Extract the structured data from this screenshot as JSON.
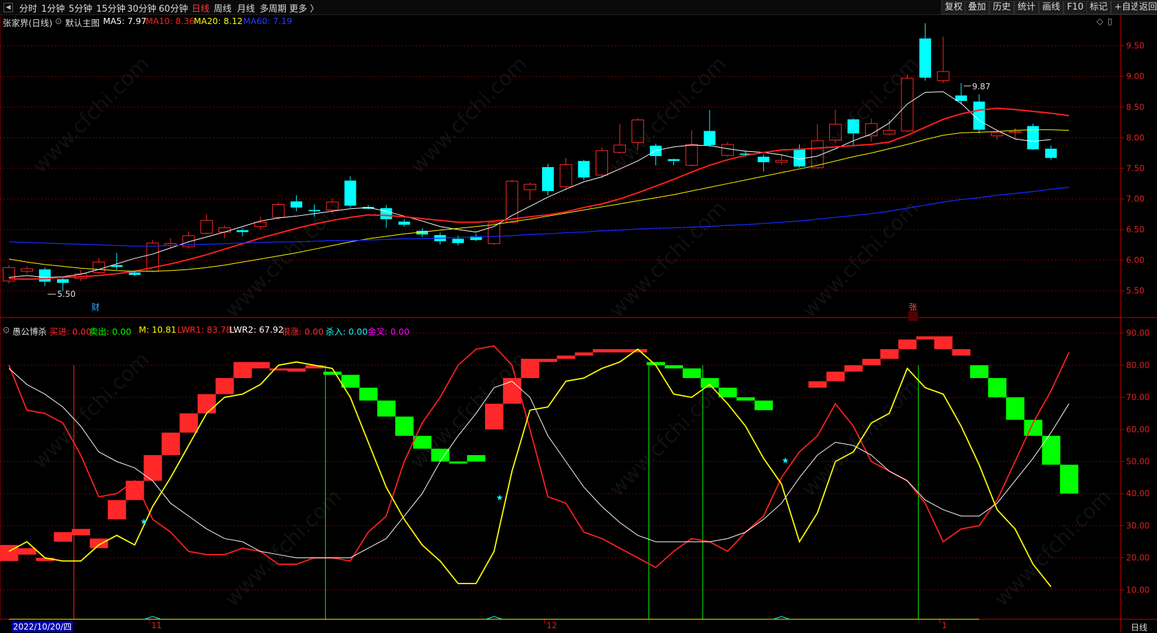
{
  "toolbar": {
    "left_items": [
      "分时",
      "1分钟",
      "5分钟",
      "15分钟",
      "30分钟",
      "60分钟",
      "日线",
      "周线",
      "月线",
      "多周期",
      "更多 〉"
    ],
    "active_item": "日线",
    "right_items": [
      "复权",
      "叠加",
      "历史",
      "统计",
      "画线",
      "F10",
      "标记",
      "+自选",
      "返回"
    ]
  },
  "main_legend": {
    "stock": "张家界(日线)",
    "main_title": "默认主图",
    "ma5": "MA5: 7.97",
    "ma10": "MA10: 8.36",
    "ma20": "MA20: 8.12",
    "ma60": "MA60: 7.19"
  },
  "sub_legend": {
    "title": "愚公博杀",
    "buy": "买进: 0.00",
    "sell": "卖出: 0.00",
    "m": "M: 10.81",
    "lwr1": "LWR1: 83.78",
    "lwr2": "LWR2: 67.92",
    "escape": "很涨: 0.00",
    "kill": "杀入: 0.00",
    "cross": "金叉: 0.00"
  },
  "colors": {
    "up": "#ff2828",
    "down": "#00ffff",
    "ma5": "#ffffff",
    "ma10": "#ff2020",
    "ma20": "#ffff00",
    "ma60": "#1428ff",
    "grid": "#800000",
    "axis": "#cc0000",
    "green_bar": "#00ff00"
  },
  "watermark": "www.cfchi.com",
  "date_flag": "2022/10/20/四",
  "period_label": "日线",
  "markers": {
    "cai": "财",
    "zhang": "张"
  },
  "chart_data": [
    {
      "type": "candlestick",
      "title": "张家界(日线)",
      "ylim": [
        5.3,
        9.9
      ],
      "yticks": [
        5.5,
        6.0,
        6.5,
        7.0,
        7.5,
        8.0,
        8.5,
        9.0,
        9.5
      ],
      "x_labels": [
        {
          "index": 8,
          "label": "11"
        },
        {
          "index": 30,
          "label": "12"
        },
        {
          "index": 52,
          "label": "1"
        }
      ],
      "annotations": [
        {
          "index": 2,
          "text": "5.50",
          "type": "low"
        },
        {
          "index": 53,
          "text": "9.87",
          "type": "high"
        }
      ],
      "candles": [
        [
          5.66,
          5.88,
          5.92,
          5.62
        ],
        [
          5.82,
          5.86,
          5.9,
          5.78
        ],
        [
          5.85,
          5.65,
          5.88,
          5.58
        ],
        [
          5.69,
          5.63,
          5.72,
          5.5
        ],
        [
          5.7,
          5.78,
          5.84,
          5.66
        ],
        [
          5.8,
          5.97,
          6.04,
          5.78
        ],
        [
          5.92,
          5.89,
          6.12,
          5.84
        ],
        [
          5.8,
          5.76,
          5.83,
          5.74
        ],
        [
          5.82,
          6.28,
          6.33,
          5.8
        ],
        [
          6.24,
          6.27,
          6.36,
          6.2
        ],
        [
          6.22,
          6.4,
          6.47,
          6.19
        ],
        [
          6.44,
          6.65,
          6.75,
          6.42
        ],
        [
          6.46,
          6.53,
          6.57,
          6.36
        ],
        [
          6.49,
          6.46,
          6.52,
          6.39
        ],
        [
          6.55,
          6.62,
          6.71,
          6.5
        ],
        [
          6.7,
          6.91,
          6.95,
          6.66
        ],
        [
          6.96,
          6.86,
          7.06,
          6.8
        ],
        [
          6.82,
          6.8,
          6.91,
          6.71
        ],
        [
          6.82,
          6.95,
          7.01,
          6.77
        ],
        [
          7.3,
          6.89,
          7.37,
          6.86
        ],
        [
          6.87,
          6.84,
          6.9,
          6.83
        ],
        [
          6.85,
          6.67,
          6.9,
          6.53
        ],
        [
          6.63,
          6.58,
          6.67,
          6.55
        ],
        [
          6.48,
          6.42,
          6.52,
          6.38
        ],
        [
          6.41,
          6.31,
          6.45,
          6.26
        ],
        [
          6.35,
          6.28,
          6.4,
          6.24
        ],
        [
          6.39,
          6.33,
          6.43,
          6.31
        ],
        [
          6.27,
          6.61,
          6.65,
          6.25
        ],
        [
          6.62,
          7.29,
          7.31,
          6.62
        ],
        [
          7.15,
          7.24,
          7.27,
          6.98
        ],
        [
          7.52,
          7.13,
          7.57,
          7.06
        ],
        [
          7.2,
          7.56,
          7.67,
          7.14
        ],
        [
          7.62,
          7.35,
          7.64,
          7.31
        ],
        [
          7.39,
          7.79,
          7.85,
          7.34
        ],
        [
          7.76,
          7.88,
          8.22,
          7.74
        ],
        [
          7.92,
          8.29,
          8.32,
          7.8
        ],
        [
          7.87,
          7.7,
          7.9,
          7.55
        ],
        [
          7.65,
          7.62,
          7.66,
          7.55
        ],
        [
          7.55,
          7.89,
          8.12,
          7.53
        ],
        [
          8.11,
          7.88,
          8.45,
          7.85
        ],
        [
          7.71,
          7.89,
          7.93,
          7.69
        ],
        [
          7.74,
          7.72,
          7.79,
          7.69
        ],
        [
          7.69,
          7.6,
          7.73,
          7.45
        ],
        [
          7.6,
          7.63,
          7.73,
          7.56
        ],
        [
          7.82,
          7.53,
          7.89,
          7.51
        ],
        [
          7.51,
          7.95,
          8.22,
          7.49
        ],
        [
          7.96,
          8.22,
          8.46,
          7.91
        ],
        [
          8.3,
          8.07,
          8.31,
          7.86
        ],
        [
          8.03,
          8.23,
          8.31,
          7.94
        ],
        [
          8.06,
          8.12,
          8.3,
          8.04
        ],
        [
          8.11,
          8.97,
          9.03,
          8.09
        ],
        [
          9.62,
          8.98,
          9.87,
          8.93
        ],
        [
          8.93,
          9.08,
          9.65,
          8.89
        ],
        [
          8.69,
          8.6,
          8.89,
          8.55
        ],
        [
          8.59,
          8.13,
          8.71,
          8.07
        ],
        [
          8.03,
          8.08,
          8.13,
          7.97
        ],
        [
          8.1,
          8.1,
          8.16,
          7.98
        ],
        [
          8.19,
          7.81,
          8.23,
          7.8
        ],
        [
          7.82,
          7.67,
          7.87,
          7.64
        ]
      ],
      "series": [
        {
          "name": "MA5",
          "values": [
            5.72,
            5.75,
            5.72,
            5.73,
            5.77,
            5.85,
            5.94,
            6.03,
            6.1,
            6.2,
            6.3,
            6.38,
            6.46,
            6.55,
            6.64,
            6.69,
            6.72,
            6.76,
            6.8,
            6.84,
            6.86,
            6.8,
            6.72,
            6.64,
            6.55,
            6.5,
            6.46,
            6.55,
            6.73,
            6.88,
            7.03,
            7.16,
            7.28,
            7.36,
            7.49,
            7.62,
            7.79,
            7.85,
            7.88,
            7.87,
            7.82,
            7.78,
            7.76,
            7.72,
            7.65,
            7.7,
            7.82,
            7.95,
            8.06,
            8.24,
            8.55,
            8.74,
            8.75,
            8.56,
            8.28,
            8.12,
            7.98,
            7.94,
            7.97
          ]
        },
        {
          "name": "MA10",
          "values": [
            5.7,
            5.69,
            5.7,
            5.72,
            5.73,
            5.75,
            5.78,
            5.82,
            5.88,
            5.94,
            6.01,
            6.09,
            6.18,
            6.27,
            6.36,
            6.44,
            6.52,
            6.59,
            6.65,
            6.7,
            6.74,
            6.73,
            6.71,
            6.68,
            6.65,
            6.62,
            6.62,
            6.64,
            6.67,
            6.71,
            6.74,
            6.79,
            6.86,
            6.92,
            7.0,
            7.1,
            7.21,
            7.32,
            7.44,
            7.55,
            7.64,
            7.71,
            7.76,
            7.8,
            7.81,
            7.83,
            7.85,
            7.87,
            7.89,
            7.93,
            8.04,
            8.17,
            8.3,
            8.39,
            8.45,
            8.48,
            8.46,
            8.43,
            8.4,
            8.36
          ]
        },
        {
          "name": "MA20",
          "values": [
            6.02,
            5.97,
            5.93,
            5.9,
            5.87,
            5.85,
            5.83,
            5.82,
            5.82,
            5.83,
            5.85,
            5.88,
            5.92,
            5.97,
            6.02,
            6.07,
            6.12,
            6.18,
            6.24,
            6.3,
            6.35,
            6.39,
            6.43,
            6.46,
            6.49,
            6.52,
            6.55,
            6.58,
            6.63,
            6.67,
            6.72,
            6.77,
            6.82,
            6.87,
            6.92,
            6.97,
            7.02,
            7.07,
            7.13,
            7.19,
            7.25,
            7.31,
            7.37,
            7.43,
            7.49,
            7.55,
            7.62,
            7.69,
            7.75,
            7.82,
            7.89,
            7.97,
            8.04,
            8.08,
            8.09,
            8.1,
            8.12,
            8.13,
            8.13,
            8.12
          ]
        },
        {
          "name": "MA60",
          "values": [
            6.3,
            6.29,
            6.28,
            6.27,
            6.26,
            6.25,
            6.24,
            6.23,
            6.23,
            6.24,
            6.25,
            6.26,
            6.27,
            6.28,
            6.29,
            6.3,
            6.3,
            6.31,
            6.32,
            6.32,
            6.33,
            6.34,
            6.35,
            6.35,
            6.36,
            6.37,
            6.38,
            6.39,
            6.4,
            6.42,
            6.43,
            6.45,
            6.46,
            6.48,
            6.49,
            6.51,
            6.52,
            6.53,
            6.54,
            6.55,
            6.57,
            6.58,
            6.6,
            6.62,
            6.64,
            6.67,
            6.7,
            6.73,
            6.76,
            6.8,
            6.85,
            6.9,
            6.95,
            6.99,
            7.02,
            7.06,
            7.09,
            7.12,
            7.16,
            7.19
          ]
        }
      ]
    },
    {
      "type": "line",
      "title": "愚公博杀",
      "ylim": [
        3,
        94
      ],
      "yticks": [
        10,
        20,
        30,
        40,
        50,
        60,
        70,
        80,
        90
      ],
      "series": [
        {
          "name": "LWR1",
          "values": [
            80,
            66,
            65,
            62,
            52,
            39,
            40,
            44,
            32,
            28,
            22,
            21,
            21,
            23,
            22,
            18,
            18,
            20,
            20,
            19,
            28,
            33,
            50,
            62,
            70,
            80,
            85,
            86,
            80,
            60,
            39,
            37,
            28,
            26,
            23,
            20,
            17,
            22,
            26,
            25,
            22,
            28,
            33,
            45,
            53,
            58,
            68,
            61,
            50,
            47,
            44,
            37,
            25,
            29,
            30,
            38,
            50,
            62,
            72,
            84
          ]
        },
        {
          "name": "LWR2",
          "values": [
            79,
            74,
            71,
            67,
            61,
            53,
            50,
            48,
            44,
            37,
            33,
            29,
            26,
            25,
            22,
            21,
            20,
            20,
            20,
            20,
            23,
            26,
            33,
            40,
            50,
            58,
            65,
            73,
            75,
            70,
            58,
            50,
            42,
            36,
            31,
            27,
            25,
            25,
            25,
            25,
            26,
            28,
            32,
            37,
            45,
            52,
            56,
            55,
            52,
            47,
            44,
            38,
            35,
            33,
            33,
            37,
            44,
            51,
            59,
            68
          ]
        },
        {
          "name": "M",
          "values": [
            22,
            25,
            20,
            19,
            19,
            24,
            27,
            24,
            36,
            45,
            55,
            65,
            70,
            71,
            74,
            80,
            81,
            80,
            79,
            70,
            56,
            42,
            32,
            24,
            19,
            12,
            12,
            22,
            47,
            66,
            67,
            75,
            76,
            79,
            81,
            85,
            80,
            71,
            70,
            74,
            68,
            61,
            51,
            43,
            25,
            34,
            50,
            53,
            62,
            65,
            79,
            73,
            71,
            61,
            49,
            35,
            29,
            18,
            11
          ]
        }
      ],
      "blocks": {
        "buy": [
          [
            19,
            24
          ],
          [
            23,
            21
          ],
          [
            19,
            20
          ],
          [
            25,
            28
          ],
          [
            27,
            29
          ],
          [
            26,
            23
          ],
          [
            32,
            38
          ],
          [
            38,
            44
          ],
          [
            44,
            52
          ],
          [
            52,
            59
          ],
          [
            59,
            65
          ],
          [
            65,
            71
          ],
          [
            71,
            76
          ],
          [
            76,
            81
          ],
          [
            81,
            79
          ],
          [
            79,
            79
          ],
          [
            79,
            78
          ],
          [
            80,
            79
          ]
        ],
        "sell": [
          [
            78,
            77
          ],
          [
            77,
            73
          ],
          [
            73,
            69
          ],
          [
            69,
            64
          ],
          [
            64,
            58
          ],
          [
            58,
            54
          ],
          [
            54,
            50
          ],
          [
            50,
            50
          ],
          [
            52,
            50
          ]
        ],
        "buy2": [
          [
            60,
            68
          ],
          [
            68,
            76
          ],
          [
            76,
            82
          ],
          [
            81,
            82
          ],
          [
            82,
            83
          ],
          [
            83,
            84
          ],
          [
            84,
            85
          ],
          [
            85,
            84
          ],
          [
            85,
            84
          ]
        ],
        "sell2": [
          [
            81,
            80
          ],
          [
            80,
            79
          ],
          [
            79,
            76
          ],
          [
            76,
            73
          ],
          [
            73,
            70
          ],
          [
            70,
            69
          ],
          [
            69,
            66
          ]
        ],
        "buy3": [
          [
            73,
            75
          ],
          [
            75,
            78
          ],
          [
            78,
            80
          ],
          [
            80,
            82
          ],
          [
            82,
            85
          ],
          [
            85,
            88
          ],
          [
            88,
            89
          ],
          [
            89,
            85
          ],
          [
            85,
            83
          ]
        ],
        "sell3": [
          [
            80,
            76
          ],
          [
            76,
            70
          ],
          [
            70,
            63
          ],
          [
            63,
            58
          ],
          [
            58,
            49
          ],
          [
            49,
            40
          ]
        ]
      }
    }
  ]
}
